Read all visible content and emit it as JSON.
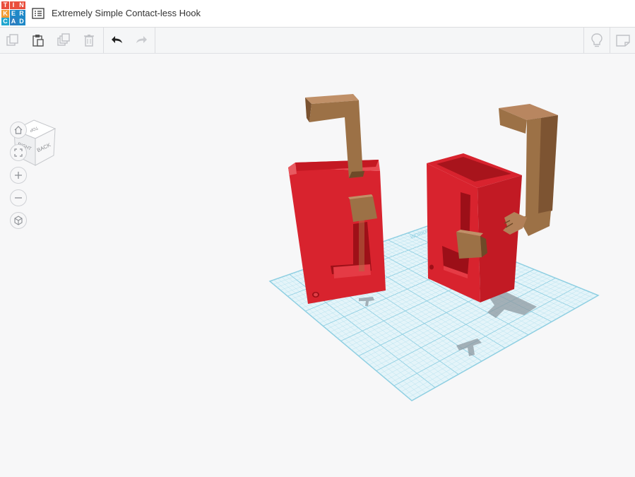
{
  "app": {
    "logo_letters": [
      "T",
      "I",
      "N",
      "K",
      "E",
      "R",
      "C",
      "A",
      "D"
    ],
    "logo_colors": [
      "#e94e3c",
      "#e94e3c",
      "#e94e3c",
      "#f39c33",
      "#1e88c7",
      "#1e88c7",
      "#22a7cf",
      "#2a7fc1",
      "#1e88c7"
    ],
    "document_title": "Extremely Simple Contact-less Hook"
  },
  "toolbar": {
    "buttons": [
      "copy-icon",
      "paste-icon",
      "duplicate-icon",
      "delete-icon",
      "undo-icon",
      "redo-icon"
    ],
    "right_buttons": [
      "lightbulb-icon",
      "notes-icon"
    ]
  },
  "viewcube": {
    "faces": [
      "TOP",
      "RIGHT",
      "BACK"
    ]
  },
  "nav_controls": [
    "home-icon",
    "fit-view-icon",
    "zoom-in-icon",
    "zoom-out-icon",
    "perspective-icon"
  ],
  "workplane": {
    "label": "WORKPLANE"
  },
  "colors": {
    "red_part": "#d8232e",
    "red_dark": "#a8141c",
    "red_light": "#e94a52",
    "brown_part": "#9c7146",
    "brown_dark": "#6e4a28",
    "grid": "#a6d9ea",
    "grid_fill": "#e4f4f9"
  }
}
